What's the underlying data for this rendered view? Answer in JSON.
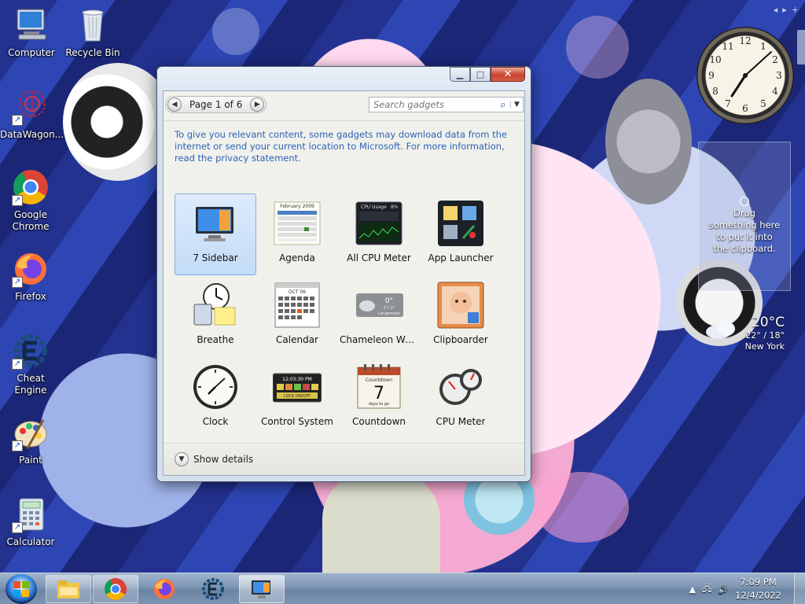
{
  "desktop": {
    "icons": [
      {
        "label": "Computer",
        "icon": "computer-icon"
      },
      {
        "label": "Recycle Bin",
        "icon": "recycle-bin-icon"
      },
      {
        "label": "DataWagon...",
        "icon": "datawagon-icon"
      },
      {
        "label": "Google Chrome",
        "icon": "chrome-icon"
      },
      {
        "label": "Firefox",
        "icon": "firefox-icon"
      },
      {
        "label": "Cheat Engine",
        "icon": "cheat-engine-icon"
      },
      {
        "label": "Paint",
        "icon": "paint-icon"
      },
      {
        "label": "Calculator",
        "icon": "calculator-icon"
      }
    ]
  },
  "gallery": {
    "page_label": "Page 1 of 6",
    "search_placeholder": "Search gadgets",
    "notice": "To give you relevant content, some gadgets may download data from the internet or send your current location to Microsoft. For more information, read the privacy statement.",
    "gadgets": [
      {
        "name": "7 Sidebar",
        "icon": "sidebar-icon",
        "selected": true
      },
      {
        "name": "Agenda",
        "icon": "agenda-icon"
      },
      {
        "name": "All CPU Meter",
        "icon": "cpu-graph-icon"
      },
      {
        "name": "App Launcher",
        "icon": "app-launcher-icon"
      },
      {
        "name": "Breathe",
        "icon": "breathe-icon"
      },
      {
        "name": "Calendar",
        "icon": "calendar-icon"
      },
      {
        "name": "Chameleon We...",
        "icon": "weather-icon"
      },
      {
        "name": "Clipboarder",
        "icon": "clipboarder-icon"
      },
      {
        "name": "Clock",
        "icon": "clock-icon"
      },
      {
        "name": "Control System",
        "icon": "control-system-icon"
      },
      {
        "name": "Countdown",
        "icon": "countdown-icon"
      },
      {
        "name": "CPU Meter",
        "icon": "cpu-meter-icon"
      }
    ],
    "thumb_text": {
      "agenda_month": "February 2009",
      "cpu_title": "CPU Usage",
      "cpu_pct": "8%",
      "calendar_month": "OCT 06",
      "weather_temp": "0°",
      "weather_range": "2°/ 2°",
      "weather_city": "Langemark",
      "control_time": "12:03:30 PM",
      "control_lock": "LOCK ON/OFF",
      "countdown_title": "Countdown",
      "countdown_num": "7",
      "countdown_caption": "days to go"
    },
    "show_details": "Show details"
  },
  "sidebar": {
    "clipboard_text": "Drag something here to put it into the clipboard.",
    "weather": {
      "temp": "20°C",
      "range": "22° / 18°",
      "city": "New York"
    }
  },
  "taskbar": {
    "apps": [
      "explorer-icon",
      "chrome-icon",
      "firefox-icon",
      "cheat-engine-icon",
      "gadgets-icon"
    ],
    "time": "7:09 PM",
    "date": "12/4/2022"
  },
  "colors": {
    "accent": "#2b62b7",
    "selection": "#c4dcf6",
    "close": "#c7432c"
  }
}
